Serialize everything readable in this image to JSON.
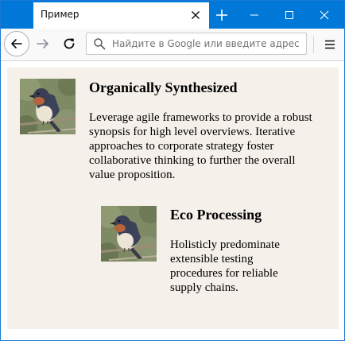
{
  "browser": {
    "tab": {
      "title": "Пример"
    },
    "urlbar": {
      "placeholder": "Найдите в Google или введите адрес"
    },
    "icons": {
      "tab_close": "close-icon",
      "new_tab": "plus-icon",
      "minimize": "minimize-icon",
      "maximize": "maximize-icon",
      "window_close": "close-icon",
      "back": "back-arrow-icon",
      "forward": "forward-arrow-icon",
      "reload": "reload-icon",
      "search": "search-icon",
      "menu": "hamburger-menu-icon"
    },
    "colors": {
      "titlebar": "#0078d7",
      "page_background": "#f5f1ea"
    }
  },
  "page": {
    "articles": [
      {
        "heading": "Organically Synthesized",
        "text": "Leverage agile frameworks to provide a robust synopsis for high level overviews. Iterative approaches to corporate strategy foster collaborative thinking to further the overall value proposition.",
        "image_icon": "bird-photo"
      },
      {
        "heading": "Eco Processing",
        "text": "Holisticly predominate extensible testing procedures for reliable supply chains.",
        "image_icon": "bird-photo"
      }
    ]
  }
}
